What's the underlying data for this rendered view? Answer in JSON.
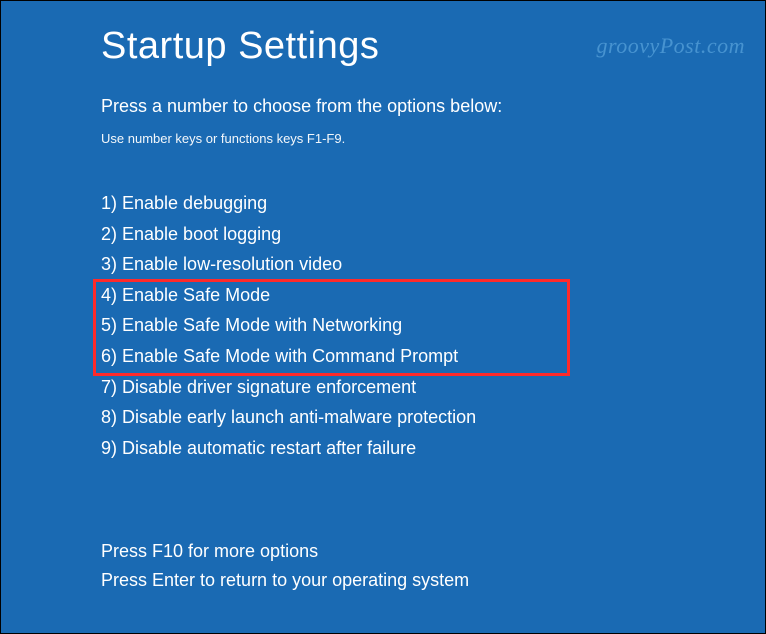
{
  "title": "Startup Settings",
  "instruction": "Press a number to choose from the options below:",
  "hint": "Use number keys or functions keys F1-F9.",
  "options": [
    "1) Enable debugging",
    "2) Enable boot logging",
    "3) Enable low-resolution video",
    "4) Enable Safe Mode",
    "5) Enable Safe Mode with Networking",
    "6) Enable Safe Mode with Command Prompt",
    "7) Disable driver signature enforcement",
    "8) Disable early launch anti-malware protection",
    "9) Disable automatic restart after failure"
  ],
  "footer": {
    "more": "Press F10 for more options",
    "return": "Press Enter to return to your operating system"
  },
  "watermark": "groovyPost.com"
}
